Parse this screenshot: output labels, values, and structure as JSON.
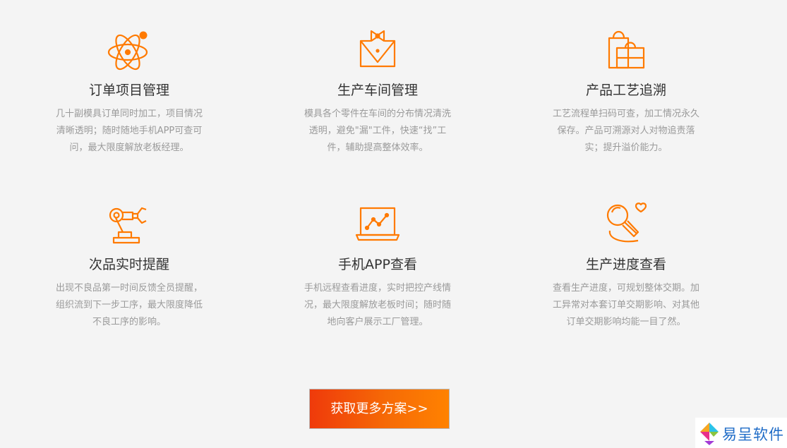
{
  "accent_color": "#ff7a00",
  "features": [
    {
      "icon": "atom-icon",
      "title": "订单项目管理",
      "desc_lines": [
        "几十副模具订单同时加工，项目情况",
        "清晰透明；随时随地手机APP可查可",
        "问，最大限度解放老板经理。"
      ]
    },
    {
      "icon": "bowtie-shirt-icon",
      "title": "生产车间管理",
      "desc_lines": [
        "模具各个零件在车间的分布情况清洗",
        "透明，避免\"漏\"工件，快速“找”工",
        "件，辅助提高整体效率。"
      ]
    },
    {
      "icon": "shopping-bag-icon",
      "title": "产品工艺追溯",
      "desc_lines": [
        "工艺流程单扫码可查，加工情况永久",
        "保存。产品可溯源对人对物追责落",
        "实；提升溢价能力。"
      ]
    },
    {
      "icon": "robot-arm-icon",
      "title": "次品实时提醒",
      "desc_lines": [
        "出现不良品第一时间反馈全员提醒，",
        "组织流到下一步工序，最大限度降低",
        "不良工序的影响。"
      ]
    },
    {
      "icon": "laptop-chart-icon",
      "title": "手机APP查看",
      "desc_lines": [
        "手机远程查看进度，实时把控产线情",
        "况，最大限度解放老板时间；随时随",
        "地向客户展示工厂管理。"
      ]
    },
    {
      "icon": "magnifier-heart-icon",
      "title": "生产进度查看",
      "desc_lines": [
        "查看生产进度，可规划整体交期。加",
        "工异常对本套订单交期影响、对其他",
        "订单交期影响均能一目了然。"
      ]
    }
  ],
  "cta": {
    "label": "获取更多方案>>"
  },
  "brand": {
    "name": "易呈软件",
    "logo_icon": "brand-logo-icon"
  }
}
